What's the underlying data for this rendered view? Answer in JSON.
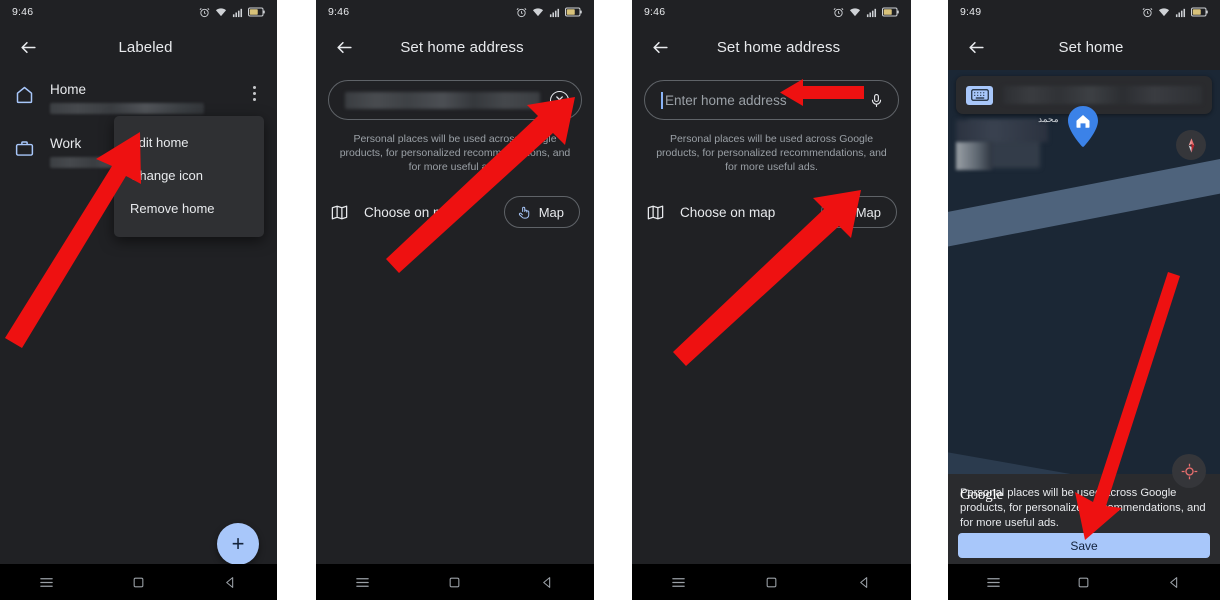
{
  "panels": [
    {
      "id": "labeled-list",
      "status": {
        "clock": "9:46",
        "icons": [
          "alarm-icon",
          "wifi-icon",
          "signal-icon",
          "battery-icon"
        ]
      },
      "appbar": {
        "back": "back-arrow-icon",
        "title": "Labeled"
      },
      "list": [
        {
          "icon": "home-icon",
          "label": "Home",
          "value_redacted": true
        },
        {
          "icon": "work-briefcase-icon",
          "label": "Work",
          "value_redacted": true
        }
      ],
      "overflow_icon": "more-vert-icon",
      "context_menu": [
        "Edit home",
        "Change icon",
        "Remove home"
      ],
      "fab": {
        "icon": "plus-icon",
        "label": "+"
      }
    },
    {
      "id": "set-home-address-filled",
      "status": {
        "clock": "9:46",
        "icons": [
          "alarm-icon",
          "wifi-icon",
          "signal-icon",
          "battery-icon"
        ]
      },
      "appbar": {
        "back": "back-arrow-icon",
        "title": "Set home address"
      },
      "search": {
        "value_redacted": true,
        "placeholder": "",
        "trailing_icon": "clear-x-icon"
      },
      "disclaimer": "Personal places will be used across Google products, for personalized recommendations, and for more useful ads.",
      "choose": {
        "icon": "map-fold-icon",
        "label": "Choose on map",
        "chip_label": "Map",
        "chip_icon": "touch-hand-icon"
      }
    },
    {
      "id": "set-home-address-empty",
      "status": {
        "clock": "9:46",
        "icons": [
          "alarm-icon",
          "wifi-icon",
          "signal-icon",
          "battery-icon"
        ]
      },
      "appbar": {
        "back": "back-arrow-icon",
        "title": "Set home address"
      },
      "search": {
        "value": "",
        "placeholder": "Enter home address",
        "trailing_icon": "microphone-icon"
      },
      "disclaimer": "Personal places will be used across Google products, for personalized recommendations, and for more useful ads.",
      "choose": {
        "icon": "map-fold-icon",
        "label": "Choose on map",
        "chip_label": "Map",
        "chip_icon": "touch-hand-icon"
      }
    },
    {
      "id": "set-home-map",
      "status": {
        "clock": "9:49",
        "icons": [
          "alarm-icon",
          "wifi-icon",
          "signal-icon",
          "battery-icon"
        ]
      },
      "appbar": {
        "back": "back-arrow-icon",
        "title": "Set home"
      },
      "map_search": {
        "icon": "keyboard-icon",
        "value_redacted": true
      },
      "map": {
        "pin_icon": "home-pin-icon",
        "street_label": "محمد",
        "compass_icon": "compass-icon",
        "locate_icon": "my-location-icon",
        "watermark": "Google"
      },
      "sheet_text": "Personal places will be used across Google products, for personalized recommendations, and for more useful ads.",
      "save_label": "Save"
    }
  ],
  "navbar": {
    "menu": "menu-icon",
    "home": "home-square-icon",
    "back": "back-triangle-icon"
  },
  "colors": {
    "panel_bg": "#202124",
    "menu_bg": "#2f3033",
    "accent_blue": "#a8c7fa",
    "text_primary": "#e8eaed",
    "text_secondary": "#9aa0a6",
    "annotation_red": "#ee1111",
    "map_bg": "#1b2735",
    "map_road": "#4e637c",
    "pin_blue": "#3b82e8"
  }
}
